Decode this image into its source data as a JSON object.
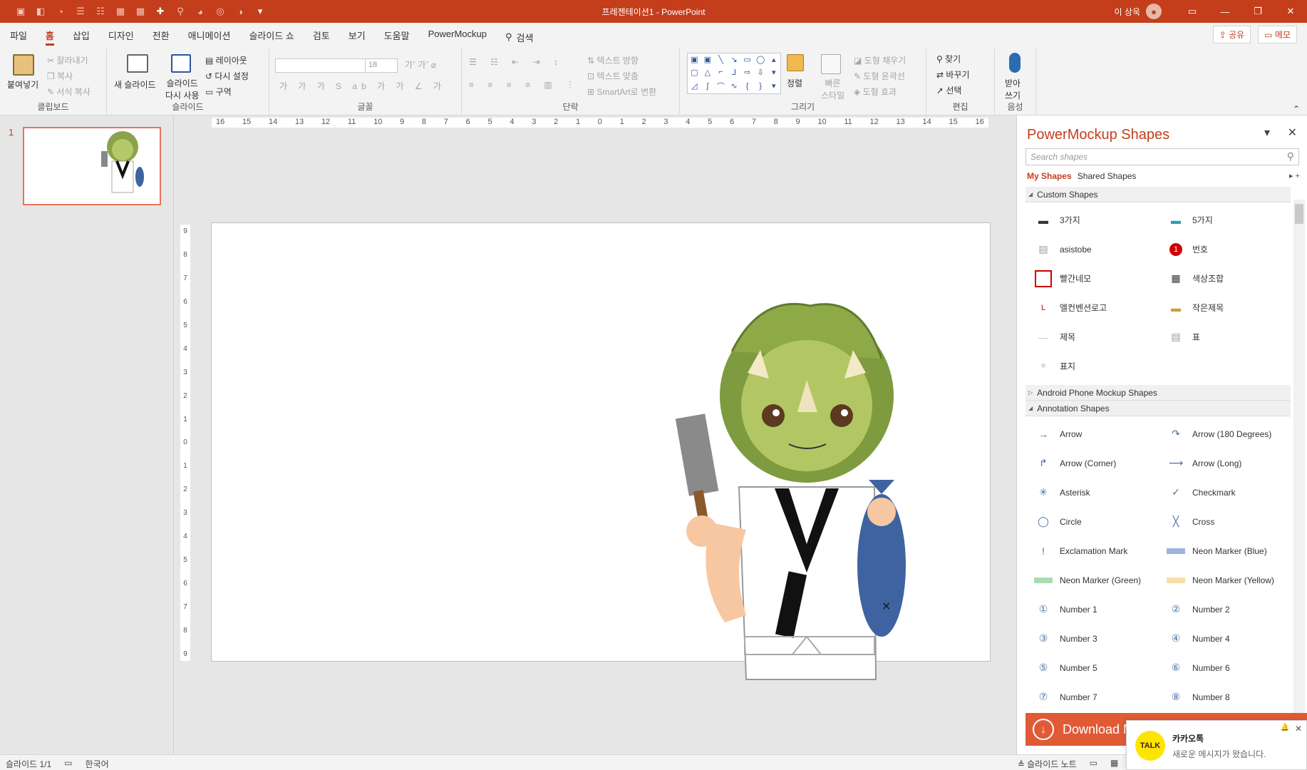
{
  "window": {
    "title": "프레젠테이션1  -  PowerPoint",
    "user_name": "이 상욱"
  },
  "menu": {
    "tabs": [
      "파일",
      "홈",
      "삽입",
      "디자인",
      "전환",
      "애니메이션",
      "슬라이드 쇼",
      "검토",
      "보기",
      "도움말",
      "PowerMockup"
    ],
    "search_label": "검색",
    "share_label": "공유",
    "memo_label": "메모"
  },
  "ribbon": {
    "clipboard": {
      "paste": "붙여넣기",
      "cut": "잘라내기",
      "copy": "복사",
      "format_painter": "서식 복사",
      "label": "클립보드"
    },
    "slides": {
      "new_slide": "새 슬라이드",
      "reuse_line1": "슬라이드",
      "reuse_line2": "다시 사용",
      "layout": "레이아웃",
      "reset": "다시 설정",
      "section": "구역",
      "label": "슬라이드"
    },
    "font": {
      "size": "18",
      "label": "글꼴"
    },
    "paragraph": {
      "text_direction": "텍스트 방향",
      "align_text": "텍스트 맞춤",
      "smartart": "SmartArt로 변환",
      "label": "단락"
    },
    "drawing": {
      "arrange": "정렬",
      "quick_styles_line1": "빠른",
      "quick_styles_line2": "스타일",
      "shape_fill": "도형 채우기",
      "shape_outline": "도형 윤곽선",
      "shape_effects": "도형 효과",
      "label": "그리기"
    },
    "editing": {
      "find": "찾기",
      "replace": "바꾸기",
      "select": "선택",
      "label": "편집"
    },
    "voice": {
      "dictate_line1": "받아",
      "dictate_line2": "쓰기",
      "label": "음성"
    }
  },
  "thumbnails": {
    "slide_number": "1"
  },
  "rulers": {
    "horizontal": [
      "16",
      "15",
      "14",
      "13",
      "12",
      "11",
      "10",
      "9",
      "8",
      "7",
      "6",
      "5",
      "4",
      "3",
      "2",
      "1",
      "0",
      "1",
      "2",
      "3",
      "4",
      "5",
      "6",
      "7",
      "8",
      "9",
      "10",
      "11",
      "12",
      "13",
      "14",
      "15",
      "16"
    ],
    "vertical": [
      "9",
      "8",
      "7",
      "6",
      "5",
      "4",
      "3",
      "2",
      "1",
      "0",
      "1",
      "2",
      "3",
      "4",
      "5",
      "6",
      "7",
      "8",
      "9"
    ]
  },
  "panel": {
    "title": "PowerMockup Shapes",
    "search_placeholder": "Search shapes",
    "tab_my": "My Shapes",
    "tab_shared": "Shared Shapes",
    "sections": {
      "custom": "Custom Shapes",
      "android": "Android Phone Mockup Shapes",
      "annotation": "Annotation Shapes"
    },
    "custom_items": [
      "3가지",
      "5가지",
      "asistobe",
      "번호",
      "빨간네모",
      "색상조합",
      "엘컨벤션로고",
      "작은제목",
      "제목",
      "표",
      "표지"
    ],
    "annotation_items": [
      "Arrow",
      "Arrow (180 Degrees)",
      "Arrow (Corner)",
      "Arrow (Long)",
      "Asterisk",
      "Checkmark",
      "Circle",
      "Cross",
      "Exclamation Mark",
      "Neon Marker (Blue)",
      "Neon Marker (Green)",
      "Neon Marker (Yellow)",
      "Number 1",
      "Number 2",
      "Number 3",
      "Number 4",
      "Number 5",
      "Number 6",
      "Number 7",
      "Number 8"
    ],
    "download_label": "Download M",
    "badge_number": "1"
  },
  "status": {
    "slide_indicator": "슬라이드 1/1",
    "language": "한국어",
    "notes": "슬라이드 노트"
  },
  "toast": {
    "logo_text": "TALK",
    "title": "카카오톡",
    "message": "새로운 메시지가 왔습니다."
  },
  "colors": {
    "brand": "#c43e1c",
    "accent": "#e05a36",
    "kakao": "#fee500"
  }
}
